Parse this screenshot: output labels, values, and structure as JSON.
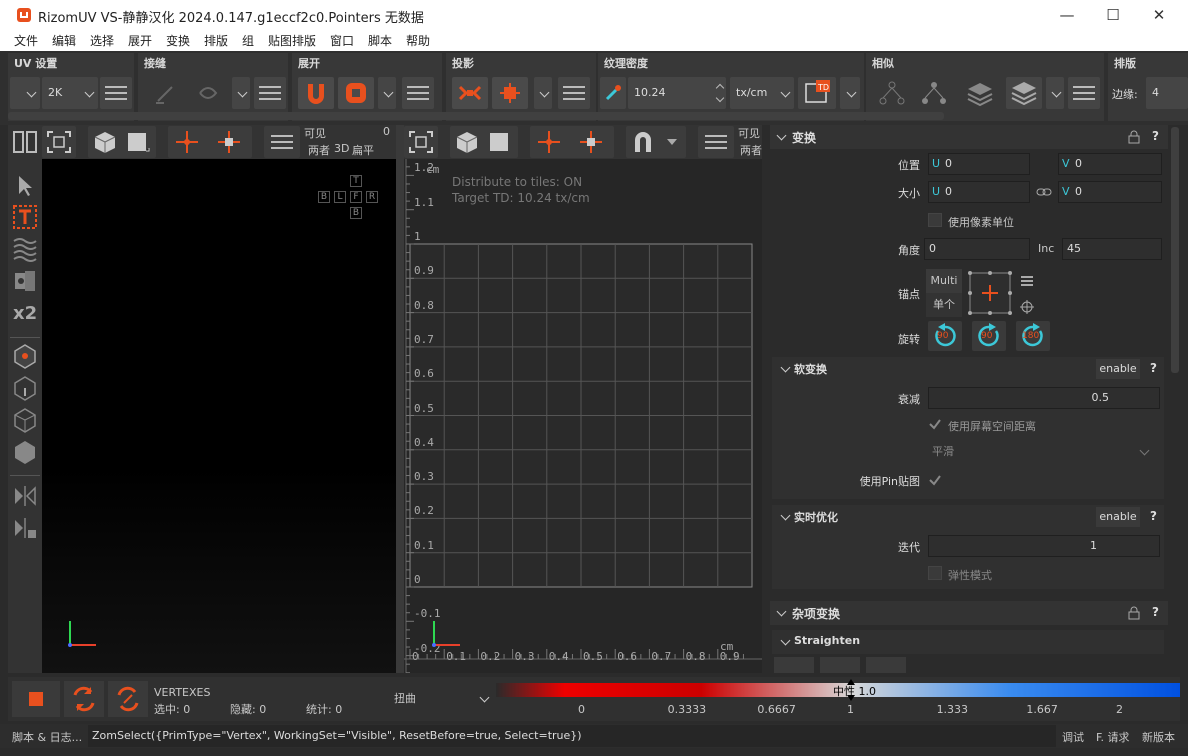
{
  "window": {
    "title": "RizomUV  VS-静静汉化 2024.0.147.g1eccf2c0.Pointers 无数据",
    "minimize": "—",
    "maximize": "☐",
    "close": "✕"
  },
  "menu": [
    "文件",
    "编辑",
    "选择",
    "展开",
    "变换",
    "排版",
    "组",
    "贴图排版",
    "窗口",
    "脚本",
    "帮助"
  ],
  "toolbar": {
    "uv_settings": {
      "title": "UV 设置",
      "resolution": "2K"
    },
    "seams": {
      "title": "接缝"
    },
    "unfold": {
      "title": "展开"
    },
    "projection": {
      "title": "投影"
    },
    "texel_density": {
      "title": "纹理密度",
      "value": "10.24",
      "unit": "tx/cm",
      "badge": "TD"
    },
    "similar": {
      "title": "相似"
    },
    "layout": {
      "title": "排版",
      "margin_label": "边缘:",
      "margin_value": "4"
    }
  },
  "viewport3d": {
    "visible_label": "可见",
    "visible_num": "0",
    "mode_both": "两者",
    "mode_3d": "3D",
    "mode_flat": "扁平",
    "nav": [
      "T",
      "B",
      "L",
      "F",
      "R",
      "B"
    ]
  },
  "uv_view": {
    "visible_label": "可见",
    "mode_both": "两者",
    "unit": "cm",
    "info1": "Distribute to tiles: ON",
    "info2": "Target TD: 10.24 tx/cm",
    "y_ticks": [
      "1.2",
      "1.1",
      "1",
      "0.9",
      "0.8",
      "0.7",
      "0.6",
      "0.5",
      "0.4",
      "0.3",
      "0.2",
      "0.1",
      "0",
      "-0.1",
      "-0.2"
    ],
    "x_ticks": [
      "0",
      "0.1",
      "0.2",
      "0.3",
      "0.4",
      "0.5",
      "0.6",
      "0.7",
      "0.8",
      "0.9"
    ]
  },
  "transform": {
    "title": "变换",
    "position": {
      "label": "位置",
      "u": "0",
      "v": "0"
    },
    "size": {
      "label": "大小",
      "u": "0",
      "v": "0"
    },
    "use_pixel_units": "使用像素单位",
    "angle": {
      "label": "角度",
      "value": "0",
      "inc_label": "Inc",
      "inc_value": "45"
    },
    "anchor": {
      "label": "锚点",
      "multi": "Multi",
      "single": "单个"
    },
    "rotate": {
      "label": "旋转",
      "r1": "90",
      "r2": "90",
      "r3": "180"
    }
  },
  "soft_transform": {
    "title": "软变换",
    "enable": "enable",
    "falloff_label": "衰减",
    "falloff_value": "0.5",
    "screen_space": "使用屏幕空间距离",
    "smooth": "平滑",
    "use_pin": "使用Pin贴图"
  },
  "live_optimize": {
    "title": "实时优化",
    "enable": "enable",
    "iter_label": "迭代",
    "iter_value": "1",
    "elastic": "弹性模式"
  },
  "misc_transform": {
    "title": "杂项变换",
    "straighten": "Straighten"
  },
  "status": {
    "mode": "VERTEXES",
    "selected": "选中: 0",
    "hidden": "隐藏: 0",
    "stats": "统计: 0",
    "distortion": "扭曲",
    "mid_label": "中性 1.0",
    "scale": [
      "0",
      "0.3333",
      "0.6667",
      "1",
      "1.333",
      "1.667",
      "2"
    ]
  },
  "console": {
    "log_label": "脚本 & 日志...",
    "command": "ZomSelect({PrimType=\"Vertex\", WorkingSet=\"Visible\", ResetBefore=true, Select=true})",
    "debug": "调试",
    "request": "F. 请求",
    "new_version": "新版本"
  },
  "colors": {
    "accent": "#e8501e",
    "cyan": "#3cc8d8"
  }
}
